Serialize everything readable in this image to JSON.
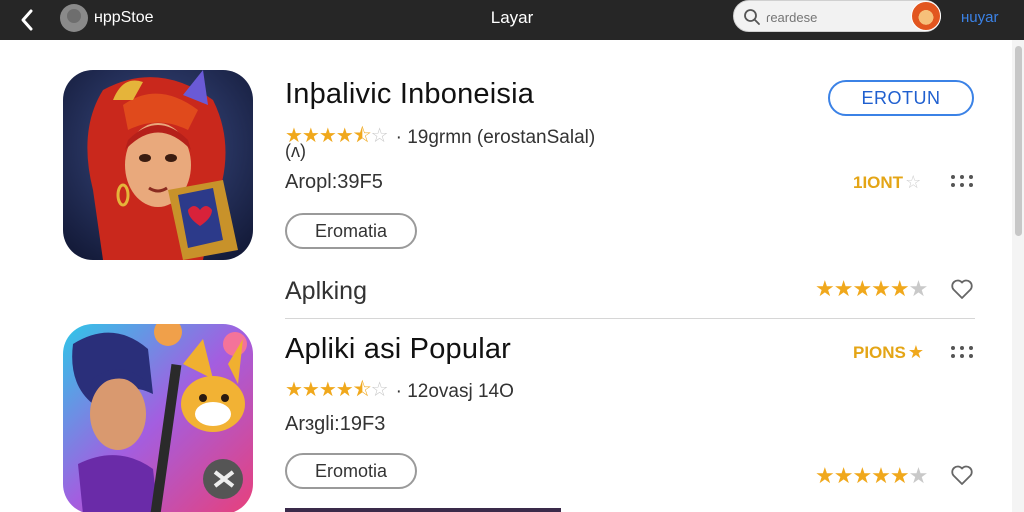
{
  "topbar": {
    "store_name": "ʜppStoe",
    "title": "Layar",
    "search_placeholder": "ɾeardese",
    "account_label": "ʜuyar"
  },
  "apps": [
    {
      "name": "Inþalivic Inboneisia",
      "rating_text": "· 19ɡrmn (erostanSalal)",
      "rating_stars": 4.5,
      "sub_meta": "(ᴧ)",
      "size": "Aropl:39F5",
      "category_button": "Eromatia",
      "get_button": "EROTUN",
      "badge": "1IONT",
      "section_label": "Aplking",
      "section_stars": 4.5
    },
    {
      "name": "Apliki asi Popular",
      "rating_text": "· 12ovasj 14O",
      "rating_stars": 4.5,
      "size": "Arɜgli:19F3",
      "category_button": "Eromotia",
      "badge": "PIONS",
      "list_stars": 4.5
    }
  ],
  "icons": {
    "back": "chevron-left-icon",
    "store": "store-logo-icon",
    "search": "search-icon",
    "more": "more-dots-icon",
    "heart": "heart-icon"
  },
  "colors": {
    "topbar": "#262626",
    "accent": "#3b82e6",
    "star": "#f0a81c",
    "badge": "#e4a516"
  }
}
